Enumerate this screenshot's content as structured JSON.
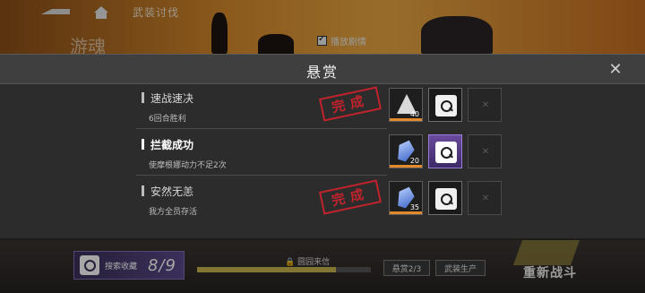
{
  "top_bar": {
    "title": "武装讨伐",
    "ghost_title": "游魂",
    "auto_replay_label": "播放剧情",
    "auto_replay_checked": true
  },
  "modal": {
    "title": "悬赏",
    "close_icon": "close-icon",
    "tasks": [
      {
        "title": "速战速决",
        "desc": "6回合胜利",
        "completed": true,
        "stamp": "完成",
        "rewards": [
          {
            "icon": "triangle-crystal-icon",
            "qty": "40"
          },
          {
            "icon": "scan-icon",
            "qty": ""
          },
          {
            "icon": "empty-slot-icon",
            "qty": ""
          }
        ]
      },
      {
        "title": "拦截成功",
        "desc": "使摩根娜动力不足2次",
        "completed": false,
        "stamp": "",
        "rewards": [
          {
            "icon": "blue-gem-icon",
            "qty": "20"
          },
          {
            "icon": "scan-icon",
            "qty": ""
          },
          {
            "icon": "empty-slot-icon",
            "qty": ""
          }
        ]
      },
      {
        "title": "安然无恙",
        "desc": "我方全员存活",
        "completed": true,
        "stamp": "完成",
        "rewards": [
          {
            "icon": "blue-gem-icon",
            "qty": "35"
          },
          {
            "icon": "scan-icon",
            "qty": ""
          },
          {
            "icon": "empty-slot-icon",
            "qty": ""
          }
        ]
      }
    ]
  },
  "bottom_hud": {
    "collect_label": "搜索收藏",
    "collect_count": "8/9",
    "lock_label": "圆园来信",
    "progress_fraction": 0.8,
    "bounty_button": "悬赏2/3",
    "arms_button": "武装生产",
    "restart_label": "重新战斗"
  },
  "colors": {
    "stamp_red": "#c0232b",
    "accent_purple": "#6a4a9e",
    "qty_orange": "#e08a2c"
  }
}
